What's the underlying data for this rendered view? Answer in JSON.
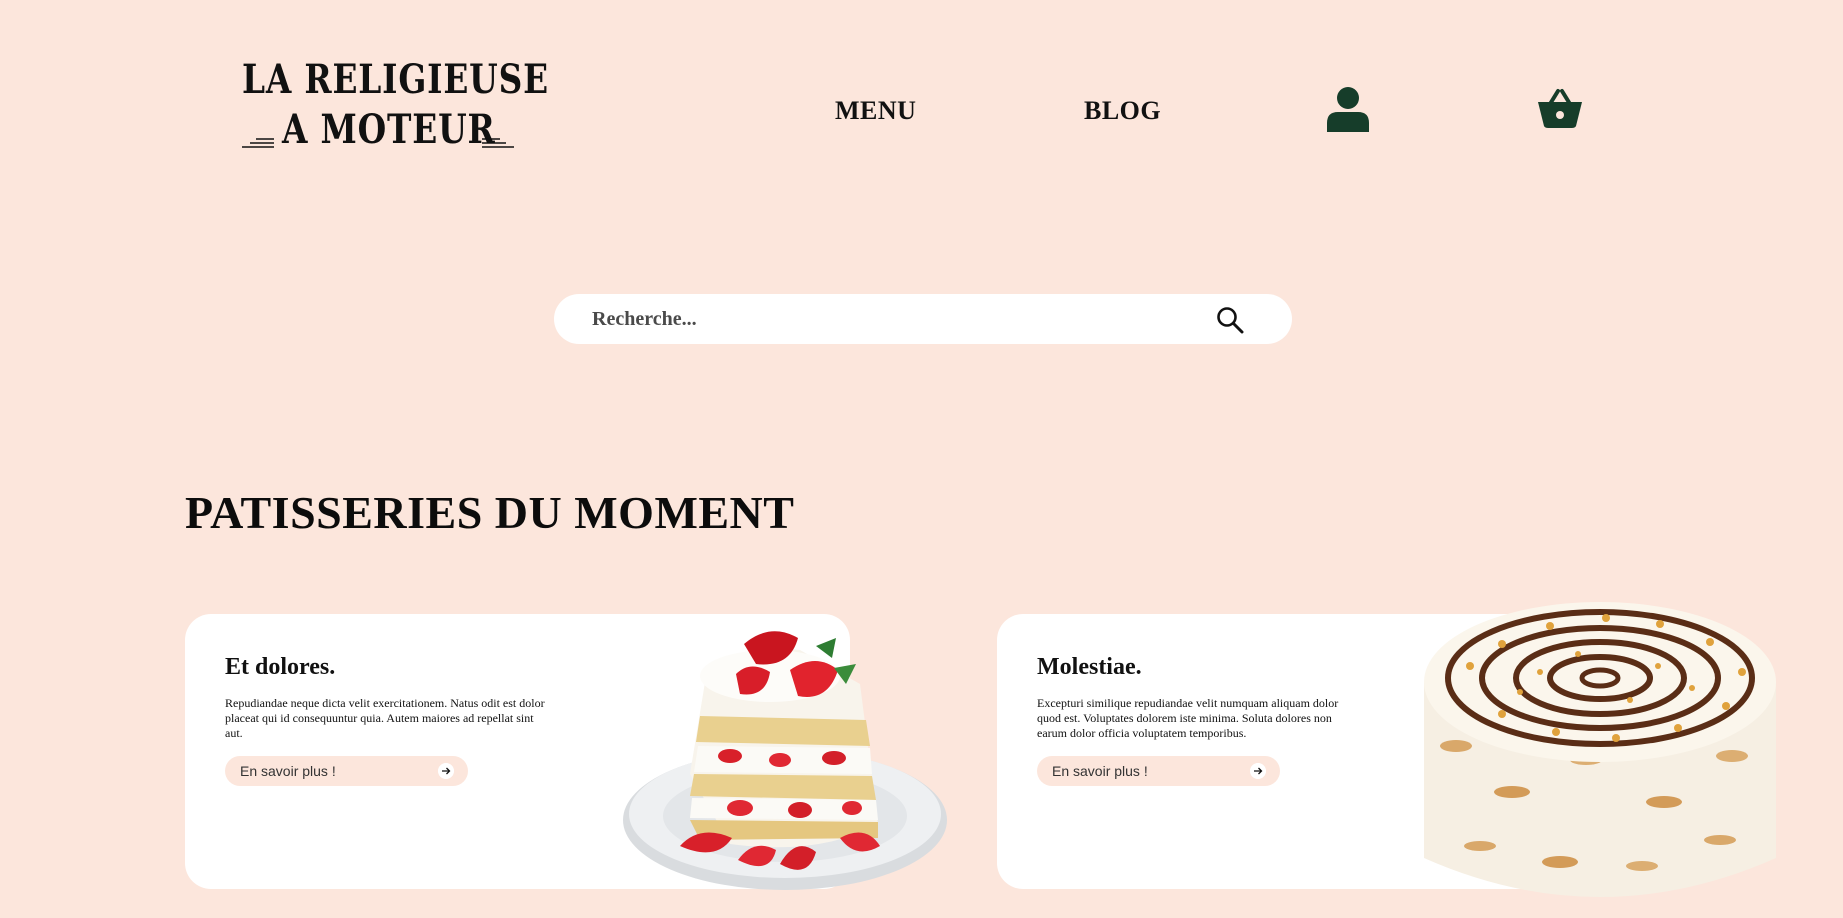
{
  "logo": {
    "line1": "LA RELIGIEUSE",
    "line2": "A MOTEUR"
  },
  "nav": {
    "menu": "MENU",
    "blog": "BLOG",
    "account_icon": "user-icon",
    "cart_icon": "basket-icon"
  },
  "search": {
    "placeholder": "Recherche...",
    "icon": "search-icon"
  },
  "section": {
    "title": "PATISSERIES DU MOMENT"
  },
  "cards": [
    {
      "title": "Et dolores.",
      "description": "Repudiandae neque dicta velit exercitationem. Natus odit est dolor placeat qui id consequuntur quia. Autem maiores ad repellat sint aut.",
      "cta": "En savoir plus !",
      "image": "strawberry-cream-cake-slice"
    },
    {
      "title": "Molestiae.",
      "description": "Excepturi similique repudiandae velit numquam aliquam dolor quod est. Voluptates dolorem iste minima. Soluta dolores non earum dolor officia voluptatem temporibus.",
      "cta": "En savoir plus !",
      "image": "chocolate-swirl-cake"
    }
  ],
  "colors": {
    "background": "#fce6dc",
    "card": "#ffffff",
    "icon_green": "#163d2a",
    "text": "#0e0e0e"
  }
}
